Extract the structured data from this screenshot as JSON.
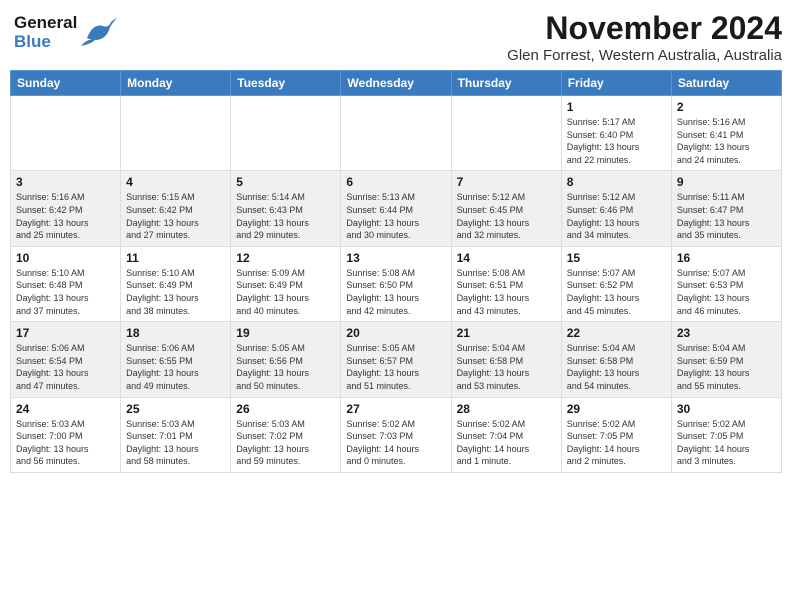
{
  "header": {
    "logo_general": "General",
    "logo_blue": "Blue",
    "title": "November 2024",
    "subtitle": "Glen Forrest, Western Australia, Australia"
  },
  "weekdays": [
    "Sunday",
    "Monday",
    "Tuesday",
    "Wednesday",
    "Thursday",
    "Friday",
    "Saturday"
  ],
  "weeks": [
    {
      "alt": false,
      "days": [
        {
          "num": "",
          "info": ""
        },
        {
          "num": "",
          "info": ""
        },
        {
          "num": "",
          "info": ""
        },
        {
          "num": "",
          "info": ""
        },
        {
          "num": "",
          "info": ""
        },
        {
          "num": "1",
          "info": "Sunrise: 5:17 AM\nSunset: 6:40 PM\nDaylight: 13 hours\nand 22 minutes."
        },
        {
          "num": "2",
          "info": "Sunrise: 5:16 AM\nSunset: 6:41 PM\nDaylight: 13 hours\nand 24 minutes."
        }
      ]
    },
    {
      "alt": true,
      "days": [
        {
          "num": "3",
          "info": "Sunrise: 5:16 AM\nSunset: 6:42 PM\nDaylight: 13 hours\nand 25 minutes."
        },
        {
          "num": "4",
          "info": "Sunrise: 5:15 AM\nSunset: 6:42 PM\nDaylight: 13 hours\nand 27 minutes."
        },
        {
          "num": "5",
          "info": "Sunrise: 5:14 AM\nSunset: 6:43 PM\nDaylight: 13 hours\nand 29 minutes."
        },
        {
          "num": "6",
          "info": "Sunrise: 5:13 AM\nSunset: 6:44 PM\nDaylight: 13 hours\nand 30 minutes."
        },
        {
          "num": "7",
          "info": "Sunrise: 5:12 AM\nSunset: 6:45 PM\nDaylight: 13 hours\nand 32 minutes."
        },
        {
          "num": "8",
          "info": "Sunrise: 5:12 AM\nSunset: 6:46 PM\nDaylight: 13 hours\nand 34 minutes."
        },
        {
          "num": "9",
          "info": "Sunrise: 5:11 AM\nSunset: 6:47 PM\nDaylight: 13 hours\nand 35 minutes."
        }
      ]
    },
    {
      "alt": false,
      "days": [
        {
          "num": "10",
          "info": "Sunrise: 5:10 AM\nSunset: 6:48 PM\nDaylight: 13 hours\nand 37 minutes."
        },
        {
          "num": "11",
          "info": "Sunrise: 5:10 AM\nSunset: 6:49 PM\nDaylight: 13 hours\nand 38 minutes."
        },
        {
          "num": "12",
          "info": "Sunrise: 5:09 AM\nSunset: 6:49 PM\nDaylight: 13 hours\nand 40 minutes."
        },
        {
          "num": "13",
          "info": "Sunrise: 5:08 AM\nSunset: 6:50 PM\nDaylight: 13 hours\nand 42 minutes."
        },
        {
          "num": "14",
          "info": "Sunrise: 5:08 AM\nSunset: 6:51 PM\nDaylight: 13 hours\nand 43 minutes."
        },
        {
          "num": "15",
          "info": "Sunrise: 5:07 AM\nSunset: 6:52 PM\nDaylight: 13 hours\nand 45 minutes."
        },
        {
          "num": "16",
          "info": "Sunrise: 5:07 AM\nSunset: 6:53 PM\nDaylight: 13 hours\nand 46 minutes."
        }
      ]
    },
    {
      "alt": true,
      "days": [
        {
          "num": "17",
          "info": "Sunrise: 5:06 AM\nSunset: 6:54 PM\nDaylight: 13 hours\nand 47 minutes."
        },
        {
          "num": "18",
          "info": "Sunrise: 5:06 AM\nSunset: 6:55 PM\nDaylight: 13 hours\nand 49 minutes."
        },
        {
          "num": "19",
          "info": "Sunrise: 5:05 AM\nSunset: 6:56 PM\nDaylight: 13 hours\nand 50 minutes."
        },
        {
          "num": "20",
          "info": "Sunrise: 5:05 AM\nSunset: 6:57 PM\nDaylight: 13 hours\nand 51 minutes."
        },
        {
          "num": "21",
          "info": "Sunrise: 5:04 AM\nSunset: 6:58 PM\nDaylight: 13 hours\nand 53 minutes."
        },
        {
          "num": "22",
          "info": "Sunrise: 5:04 AM\nSunset: 6:58 PM\nDaylight: 13 hours\nand 54 minutes."
        },
        {
          "num": "23",
          "info": "Sunrise: 5:04 AM\nSunset: 6:59 PM\nDaylight: 13 hours\nand 55 minutes."
        }
      ]
    },
    {
      "alt": false,
      "days": [
        {
          "num": "24",
          "info": "Sunrise: 5:03 AM\nSunset: 7:00 PM\nDaylight: 13 hours\nand 56 minutes."
        },
        {
          "num": "25",
          "info": "Sunrise: 5:03 AM\nSunset: 7:01 PM\nDaylight: 13 hours\nand 58 minutes."
        },
        {
          "num": "26",
          "info": "Sunrise: 5:03 AM\nSunset: 7:02 PM\nDaylight: 13 hours\nand 59 minutes."
        },
        {
          "num": "27",
          "info": "Sunrise: 5:02 AM\nSunset: 7:03 PM\nDaylight: 14 hours\nand 0 minutes."
        },
        {
          "num": "28",
          "info": "Sunrise: 5:02 AM\nSunset: 7:04 PM\nDaylight: 14 hours\nand 1 minute."
        },
        {
          "num": "29",
          "info": "Sunrise: 5:02 AM\nSunset: 7:05 PM\nDaylight: 14 hours\nand 2 minutes."
        },
        {
          "num": "30",
          "info": "Sunrise: 5:02 AM\nSunset: 7:05 PM\nDaylight: 14 hours\nand 3 minutes."
        }
      ]
    }
  ]
}
